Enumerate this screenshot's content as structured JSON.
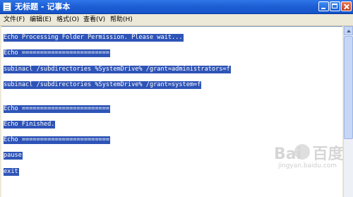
{
  "window": {
    "title": "无标题 - 记事本",
    "colors": {
      "titlebar": "#1f5fd6",
      "selection": "#2e54b7",
      "text": "#ffffff"
    }
  },
  "menu": [
    {
      "label": "文件(F)"
    },
    {
      "label": "编辑(E)"
    },
    {
      "label": "格式(O)"
    },
    {
      "label": "查看(V)"
    },
    {
      "label": "帮助(H)"
    }
  ],
  "editor": {
    "lines": [
      "Echo Processing Folder Permission. Please wait...",
      "Echo ========================",
      "subinacl /subdirectories %SystemDrive% /grant=administrators=f",
      "subinacl /subdirectories %SystemDrive% /grant=system=f",
      "Echo ========================",
      "Echo Finished.",
      "Echo ========================",
      "pause",
      "exit"
    ]
  },
  "watermark": {
    "logo": "Bai  百度",
    "url": "jingyan.baidu.com"
  },
  "icons": [
    "notepad-icon",
    "minimize-icon",
    "maximize-icon",
    "close-icon",
    "scroll-up-arrow-icon",
    "baidu-paw-icon"
  ]
}
